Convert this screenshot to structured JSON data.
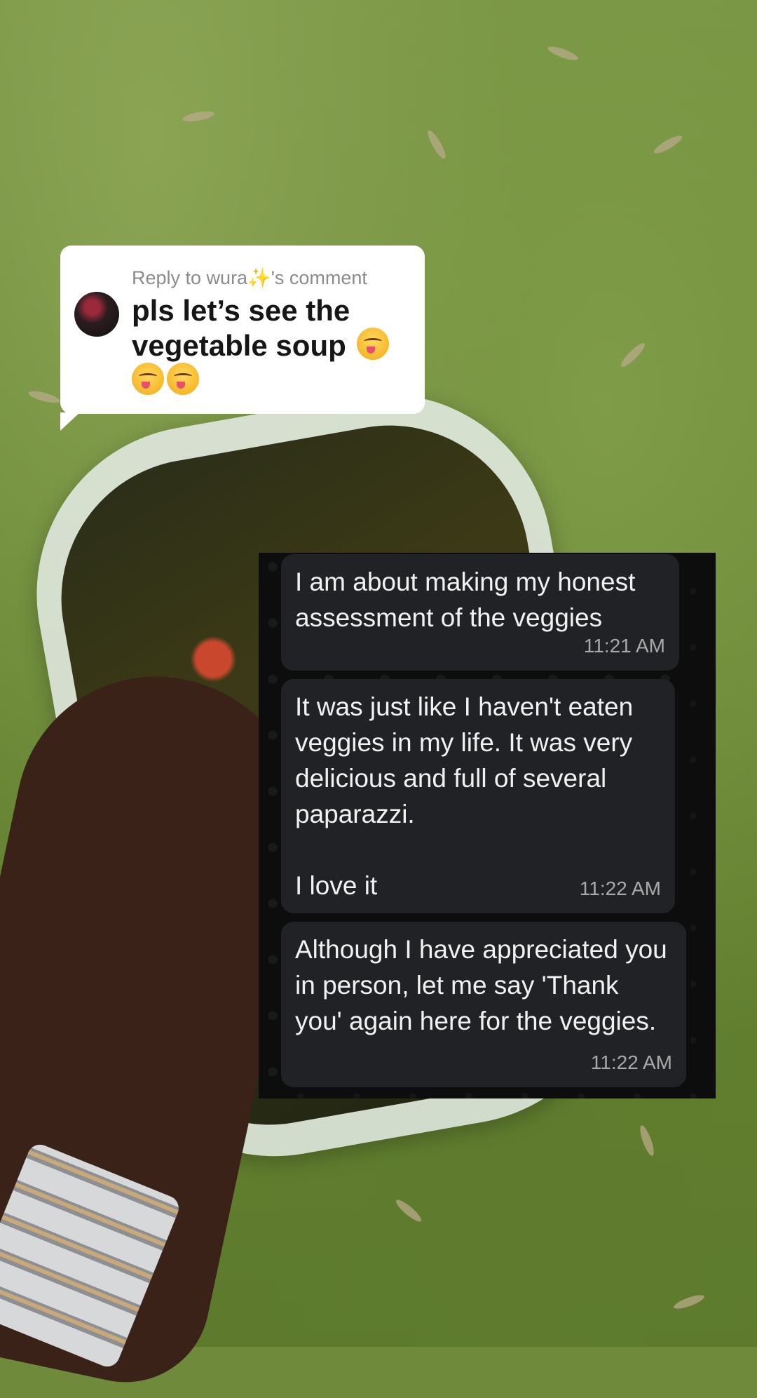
{
  "reply": {
    "caption_prefix": "Reply to wura",
    "caption_sparkle": "✨",
    "caption_suffix": "'s comment",
    "comment_text": "pls let’s see the vegetable soup"
  },
  "chat": {
    "messages": [
      {
        "text": "I am about making my honest assessment of the veggies",
        "time": "11:21 AM"
      },
      {
        "text": "It was just like I haven't eaten veggies in my life. It was very delicious and full of several paparazzi.\n\nI love it",
        "time": "11:22 AM"
      },
      {
        "text": "Although I have appreciated you in person, let me say 'Thank you' again here for the veggies.",
        "time": "11:22 AM"
      }
    ]
  },
  "icons": {
    "comment_emoji": "face-savoring-food",
    "caption_sparkle": "sparkles"
  }
}
